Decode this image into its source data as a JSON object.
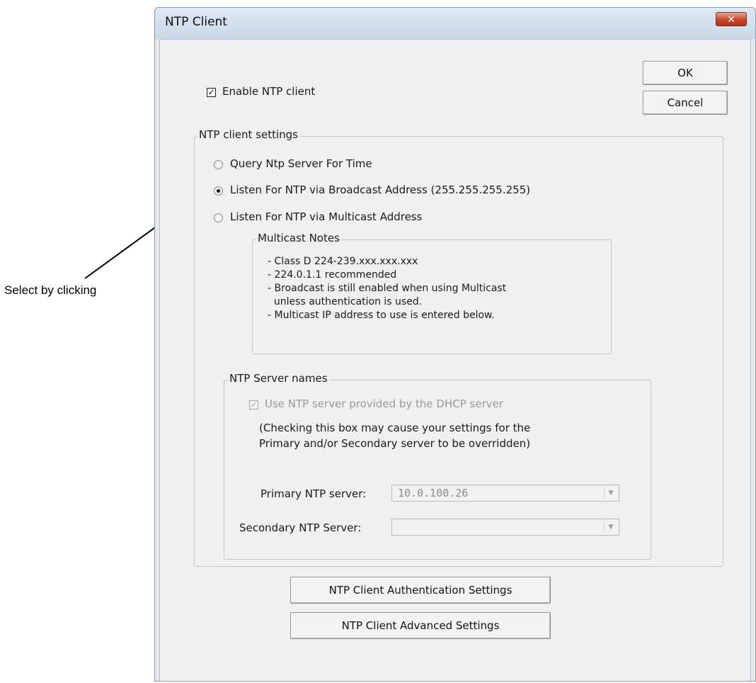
{
  "annotation": {
    "text": "Select by clicking"
  },
  "window": {
    "title": "NTP Client",
    "close_glyph": "✕"
  },
  "buttons": {
    "ok": "OK",
    "cancel": "Cancel",
    "auth": "NTP Client Authentication Settings",
    "advanced": "NTP Client Advanced Settings"
  },
  "enable": {
    "label": "Enable NTP client",
    "checked": true
  },
  "settings": {
    "group_title": "NTP client settings",
    "radios": [
      {
        "label": "Query Ntp Server For Time",
        "selected": false
      },
      {
        "label": "Listen For NTP via Broadcast Address (255.255.255.255)",
        "selected": true
      },
      {
        "label": "Listen For NTP via Multicast Address",
        "selected": false
      }
    ],
    "multicast_notes": {
      "title": "Multicast Notes",
      "lines": [
        "- Class D 224-239.xxx.xxx.xxx",
        "- 224.0.1.1 recommended",
        "- Broadcast is still enabled when using Multicast",
        "  unless authentication is used.",
        "- Multicast IP address to use is entered below."
      ]
    }
  },
  "server_names": {
    "group_title": "NTP Server names",
    "dhcp_label": "Use NTP server provided by the DHCP server",
    "dhcp_checked": true,
    "note_lines": [
      "(Checking this box may cause your settings for the",
      "Primary and/or Secondary server to be overridden)"
    ],
    "primary_label": "Primary NTP server:",
    "primary_value": "10.0.100.26",
    "secondary_label": "Secondary NTP Server:",
    "secondary_value": ""
  },
  "icons": {
    "close": "close-icon",
    "checkmark": "checkmark-icon",
    "dropdown": "chevron-down-icon",
    "pointer_arrow": "annotation-arrow-icon"
  }
}
